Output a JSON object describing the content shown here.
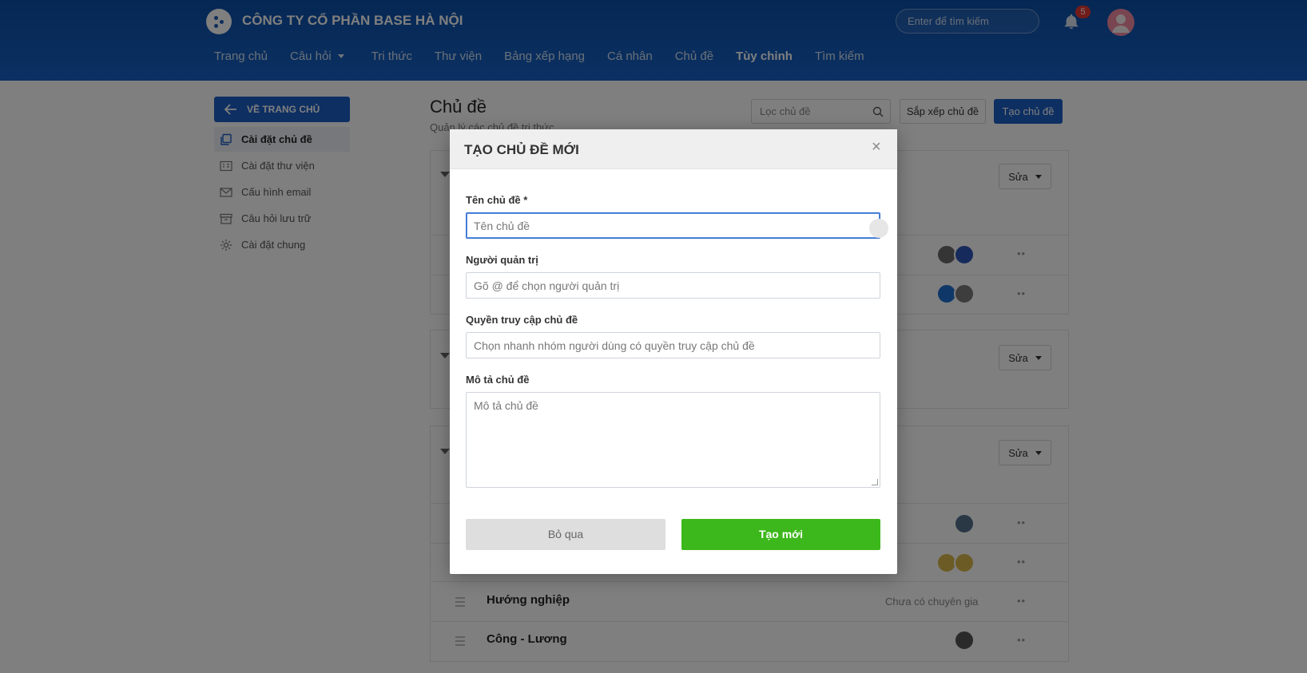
{
  "header": {
    "company": "CÔNG TY CỔ PHẦN BASE HÀ NỘI",
    "search_placeholder": "Enter để tìm kiếm",
    "notification_count": "5",
    "nav": [
      "Trang chủ",
      "Câu hỏi",
      "Tri thức",
      "Thư viện",
      "Bảng xếp hạng",
      "Cá nhân",
      "Chủ đề",
      "Tùy chỉnh",
      "Tìm kiếm"
    ],
    "active_nav": "Tùy chỉnh"
  },
  "sidebar": {
    "back_label": "VỀ TRANG CHỦ",
    "items": [
      {
        "label": "Cài đặt chủ đề",
        "icon": "copy-icon",
        "active": true
      },
      {
        "label": "Cài đặt thư viện",
        "icon": "library-icon",
        "active": false
      },
      {
        "label": "Cấu hình email",
        "icon": "mail-icon",
        "active": false
      },
      {
        "label": "Câu hỏi lưu trữ",
        "icon": "archive-icon",
        "active": false
      },
      {
        "label": "Cài đặt chung",
        "icon": "gear-icon",
        "active": false
      }
    ]
  },
  "main": {
    "title": "Chủ đề",
    "subtitle": "Quản lý các chủ đề tri thức",
    "filter_placeholder": "Lọc chủ đề",
    "sort_label": "Sắp xếp chủ đề",
    "create_label": "Tạo chủ đề",
    "edit_label": "Sửa",
    "rows": [
      {
        "title": "Hướng nghiệp",
        "status": "Chưa có chuyên gia"
      },
      {
        "title": "Công - Lương",
        "status": ""
      }
    ]
  },
  "modal": {
    "title": "TẠO CHỦ ĐỀ MỚI",
    "close": "×",
    "fields": [
      {
        "label": "Tên chủ đề *",
        "placeholder": "Tên chủ đề"
      },
      {
        "label": "Người quản trị",
        "placeholder": "Gõ @ để chọn người quản trị"
      },
      {
        "label": "Quyền truy cập chủ đề",
        "placeholder": "Chọn nhanh nhóm người dùng có quyền truy cập chủ đề"
      },
      {
        "label": "Mô tả chủ đề",
        "placeholder": "Mô tả chủ đề"
      }
    ],
    "cancel_label": "Bỏ qua",
    "submit_label": "Tạo mới"
  },
  "colors": {
    "header_blue": "#1661c4",
    "primary_blue": "#1d5fc4",
    "submit_green": "#3db81c",
    "badge_red": "#e53935"
  }
}
